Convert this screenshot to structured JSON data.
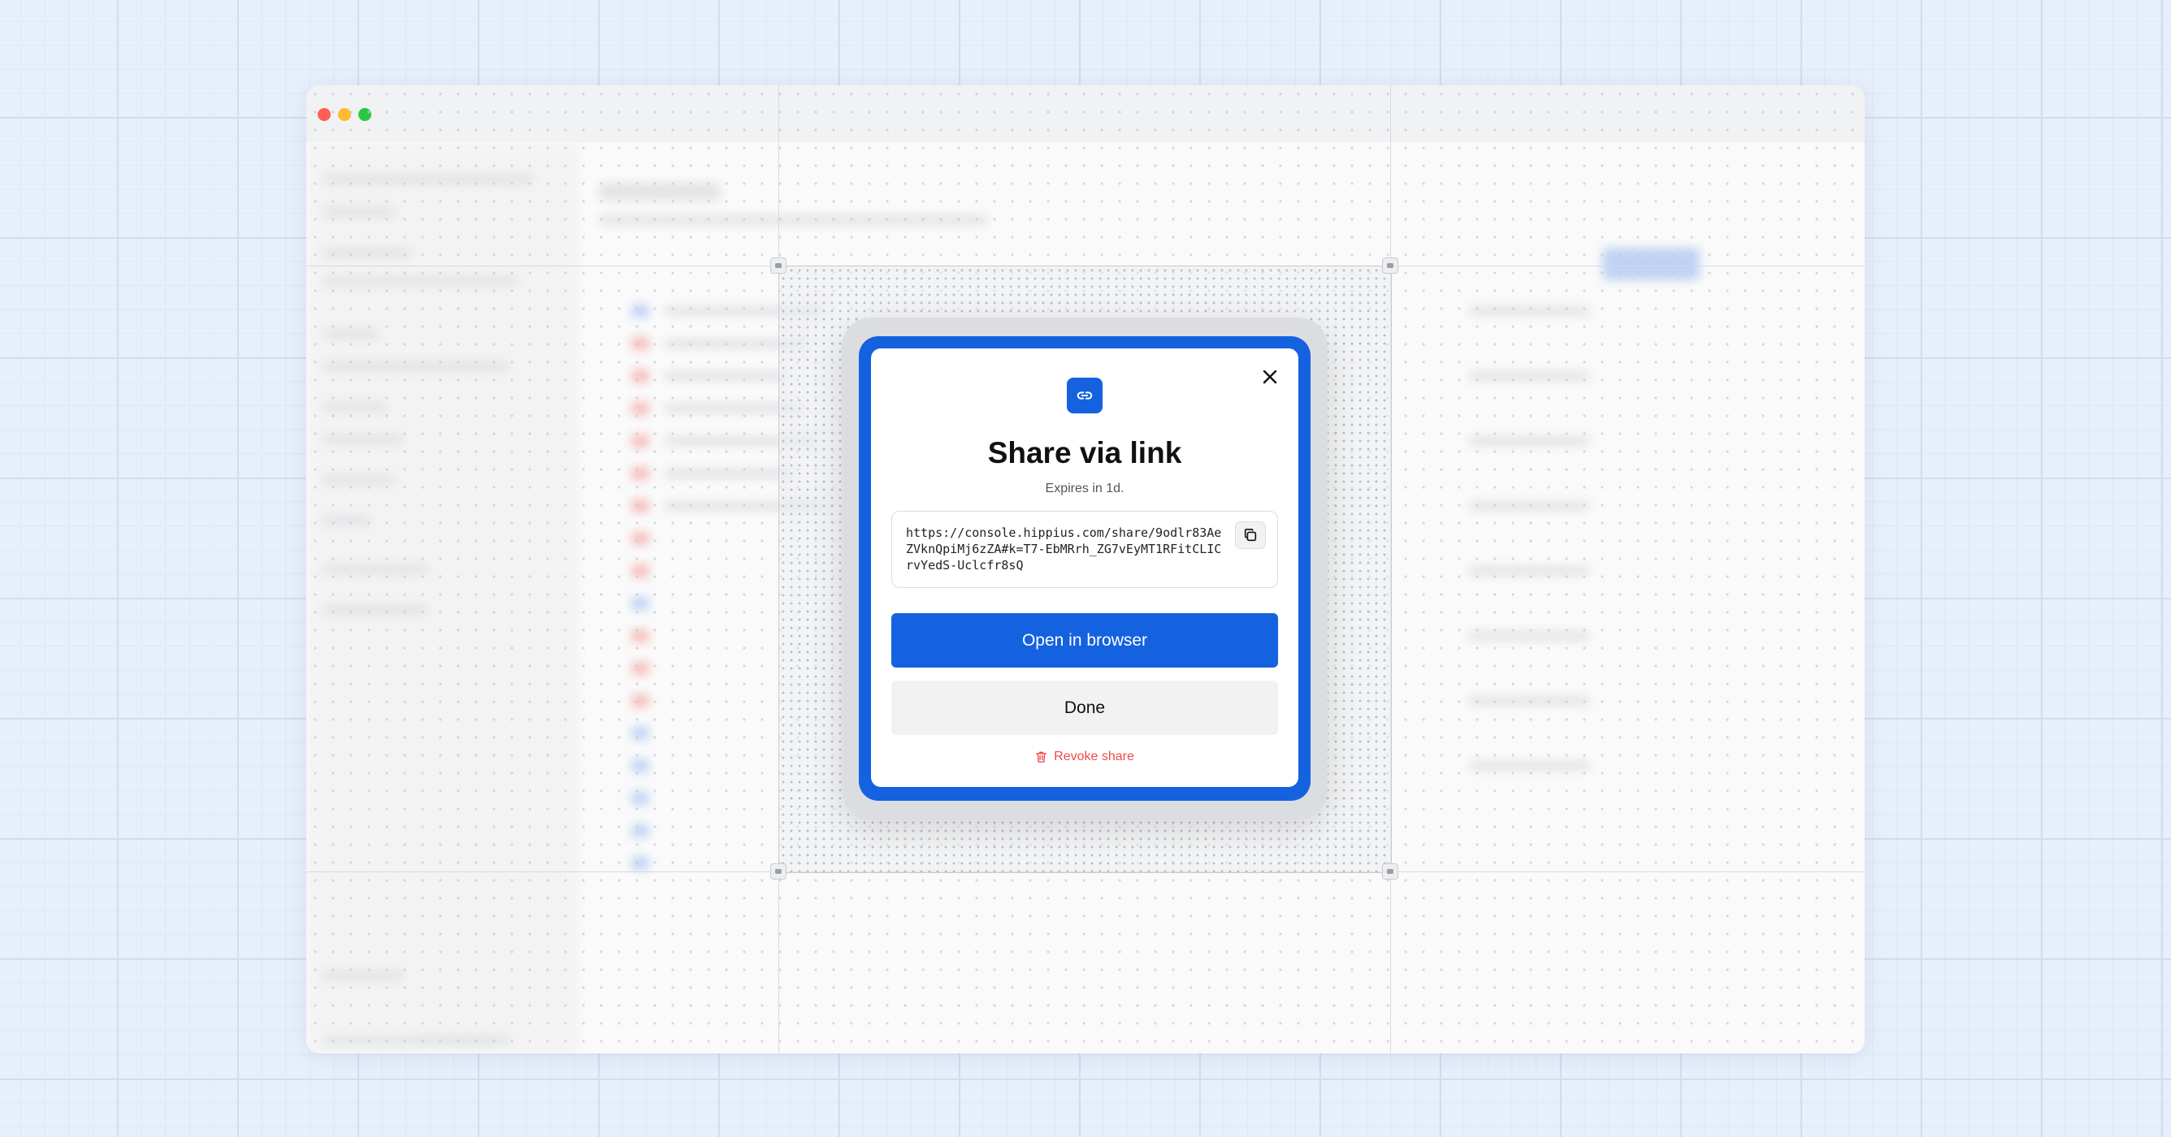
{
  "window": {
    "controls": [
      "close",
      "minimize",
      "maximize"
    ]
  },
  "dialog": {
    "title": "Share via link",
    "subtitle": "Expires in 1d.",
    "url": "https://console.hippius.com/share/9odlr83AeZVknQpiMj6zZA#k=T7-EbMRrh_ZG7vEyMT1RFitCLICrvYedS-Uclcfr8sQ",
    "open_label": "Open in browser",
    "done_label": "Done",
    "revoke_label": "Revoke share",
    "icons": {
      "header": "link-icon",
      "close": "close-icon",
      "copy": "copy-icon",
      "revoke": "trash-icon"
    },
    "colors": {
      "accent": "#1462e0",
      "danger": "#ef4b4b"
    }
  }
}
